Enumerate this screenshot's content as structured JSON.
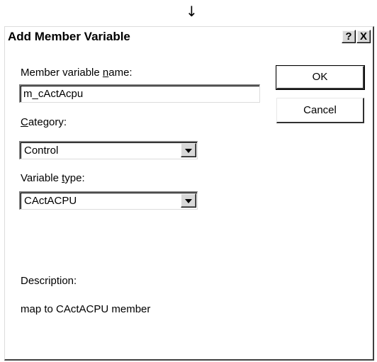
{
  "top_arrow": "↓",
  "dialog": {
    "title": "Add Member Variable",
    "help_button": "?",
    "close_button": "X"
  },
  "member_name": {
    "label_pre": "Member variable ",
    "label_key": "n",
    "label_post": "ame:",
    "value": "m_cActAcpu"
  },
  "category": {
    "label_key": "C",
    "label_post": "ategory:",
    "value": "Control"
  },
  "variable_type": {
    "label_pre": "Variable ",
    "label_key": "t",
    "label_post": "ype:",
    "value": "CActACPU"
  },
  "buttons": {
    "ok": "OK",
    "cancel": "Cancel"
  },
  "description": {
    "label": "Description:",
    "text": "map to CActACPU member"
  }
}
